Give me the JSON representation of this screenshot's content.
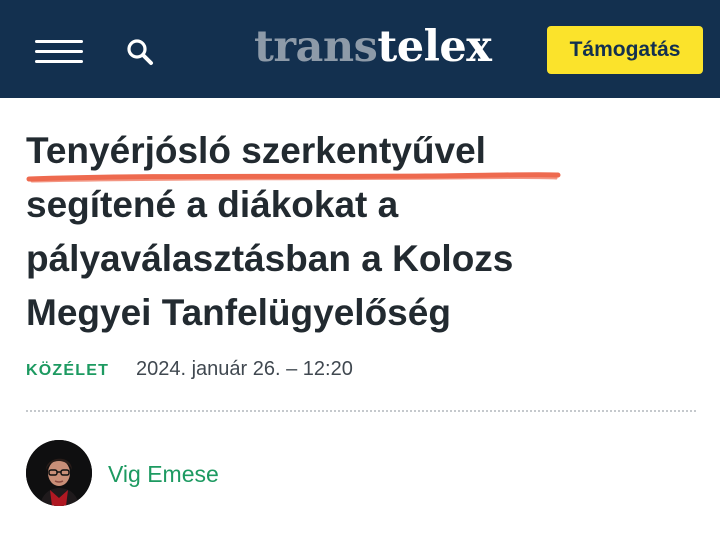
{
  "header": {
    "logo_part1": "trans",
    "logo_part2": "telex",
    "support_label": "Támogatás",
    "icons": [
      "menu-icon",
      "search-icon"
    ]
  },
  "article": {
    "headline_lines": [
      "Tenyérjósló szerkentyűvel",
      "segítené a diákokat a",
      "pályaválasztásban a Kolozs",
      "Megyei Tanfelügyelőség"
    ],
    "category": "KÖZÉLET",
    "date": "2024. január 26. – 12:20",
    "author": "Vig Emese"
  },
  "colors": {
    "header_bg": "#13304f",
    "accent_yellow": "#fbe32b",
    "link_green": "#1d9a61",
    "highlight_underline": "#ee6a4f",
    "headline_text": "#222a30"
  }
}
